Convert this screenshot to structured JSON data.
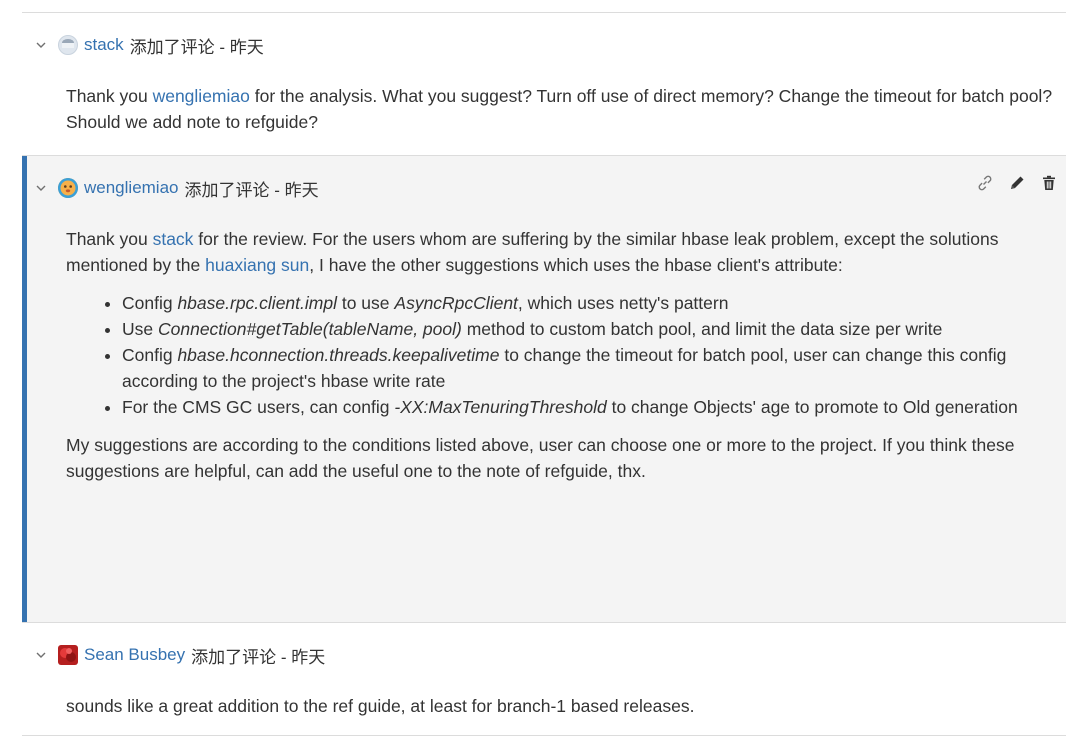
{
  "comments": [
    {
      "user": "stack",
      "meta": "添加了评论 - 昨天",
      "body": {
        "t1": "Thank you ",
        "mention": "wengliemiao",
        "t2": " for the analysis. What you suggest? Turn off use of direct memory? Change the timeout for batch pool? Should we add note to refguide?"
      }
    },
    {
      "user": "wengliemiao",
      "meta": "添加了评论 - 昨天",
      "actions": [
        "link-icon",
        "edit-icon",
        "trash-icon"
      ],
      "body": {
        "intro": {
          "t1": "Thank you ",
          "mention1": "stack",
          "t2": " for the review. For the users whom are suffering by the similar hbase leak problem, except the solutions mentioned by the ",
          "mention2": "huaxiang sun",
          "t3": ", I have the other suggestions which uses the hbase client's attribute:"
        },
        "bullets": [
          {
            "pre": "Config ",
            "code": "hbase.rpc.client.impl",
            "mid": " to use ",
            "code2": "AsyncRpcClient",
            "post": ", which uses netty's pattern"
          },
          {
            "pre": "Use ",
            "code": "Connection#getTable(tableName, pool)",
            "post": " method to custom batch pool, and limit the data size per write"
          },
          {
            "pre": "Config ",
            "code": "hbase.hconnection.threads.keepalivetime",
            "post": " to change the timeout for batch pool, user can change this config according to the project's hbase write rate"
          },
          {
            "pre": "For the CMS GC users, can config ",
            "code": "-XX:MaxTenuringThreshold",
            "post": " to change Objects' age to promote to  Old generation"
          }
        ],
        "outro": "My suggestions are according to the conditions listed above, user can choose one or more to the project. If you think these suggestions are helpful, can add the useful one to the note of refguide, thx."
      }
    },
    {
      "user": "Sean Busbey",
      "meta": "添加了评论 - 昨天",
      "body": {
        "text": "sounds like a great addition to the ref guide, at least for branch-1 based releases."
      }
    }
  ]
}
